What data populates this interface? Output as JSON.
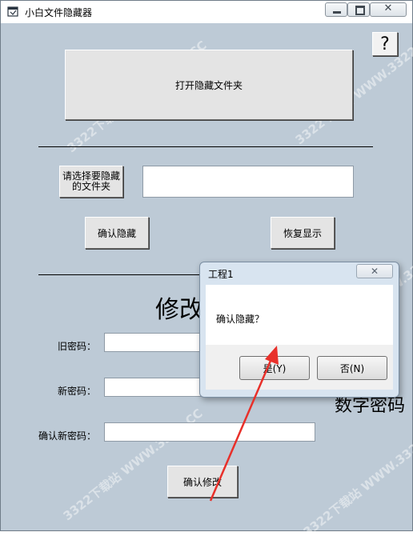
{
  "window": {
    "title": "小白文件隐藏器",
    "controls": {
      "minimize": "",
      "maximize": "",
      "close": "✕"
    }
  },
  "help": {
    "label": "?"
  },
  "open_folder": {
    "label": "打开隐藏文件夹"
  },
  "choose_folder": {
    "label": "请选择要隐藏的文件夹"
  },
  "folder_path": {
    "value": ""
  },
  "buttons": {
    "confirm_hide": "确认隐藏",
    "restore": "恢复显示",
    "confirm_modify": "确认修改"
  },
  "modify_section": {
    "title": "修改",
    "old_password_label": "旧密码：",
    "new_password_label": "新密码：",
    "confirm_password_label": "确认新密码：",
    "note": "数字密码"
  },
  "dialog": {
    "title": "工程1",
    "close": "✕",
    "message": "确认隐藏？",
    "yes": "是(Y)",
    "no": "否(N)"
  },
  "watermark": "3322下载站 WWW.3322.CC",
  "colors": {
    "window_bg": "#bdcad6",
    "dialog_bg": "#d8e4f0",
    "arrow": "#e8302a"
  }
}
